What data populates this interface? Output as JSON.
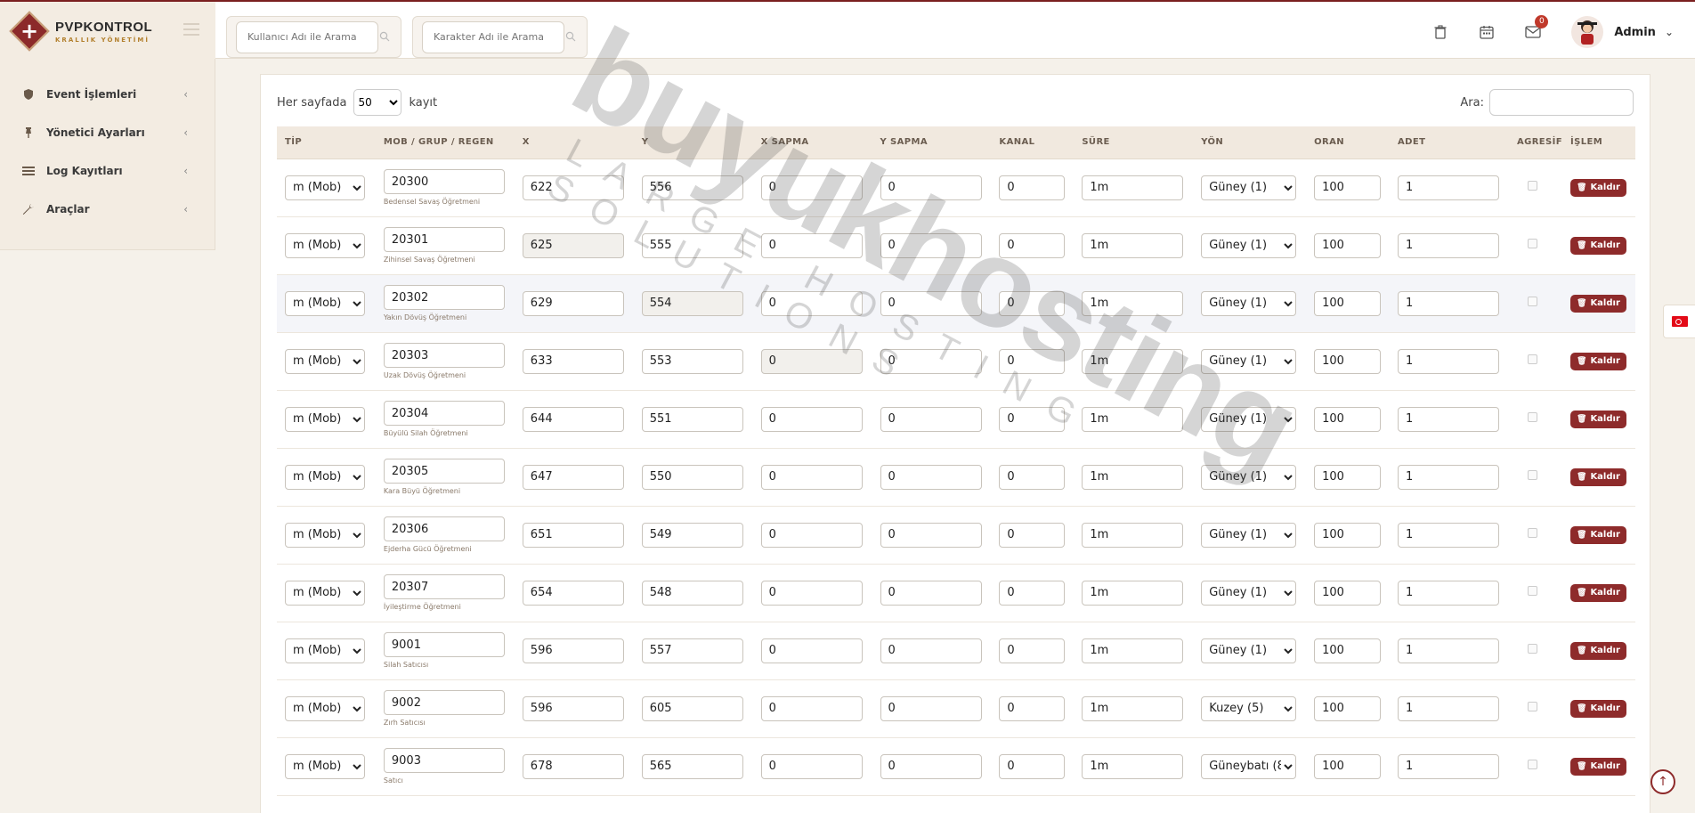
{
  "brand": {
    "title": "PVPKONTROL",
    "subtitle": "KRALLIK YÖNETİMİ"
  },
  "search": {
    "user_placeholder": "Kullanıcı Adı ile Arama",
    "char_placeholder": "Karakter Adı ile Arama"
  },
  "header": {
    "mail_badge": "0",
    "admin_name": "Admin"
  },
  "sidebar": {
    "items": [
      {
        "label": "Event İşlemleri",
        "icon": "shield-icon"
      },
      {
        "label": "Yönetici Ayarları",
        "icon": "pin-icon"
      },
      {
        "label": "Log Kayıtları",
        "icon": "list-icon"
      },
      {
        "label": "Araçlar",
        "icon": "wrench-icon"
      }
    ]
  },
  "table_controls": {
    "per_page_prefix": "Her sayfada",
    "per_page_value": "50",
    "per_page_suffix": "kayıt",
    "search_label": "Ara:"
  },
  "columns": [
    "TİP",
    "MOB / GRUP / REGEN",
    "X",
    "Y",
    "X SAPMA",
    "Y SAPMA",
    "KANAL",
    "SÜRE",
    "YÖN",
    "ORAN",
    "ADET",
    "AGRESİF",
    "İŞLEM"
  ],
  "delete_label": "Kaldır",
  "rows": [
    {
      "tip": "m (Mob)",
      "mob": "20300",
      "mob_name": "Bedensel Savaş Öğretmeni",
      "x": "622",
      "y": "556",
      "xs": "0",
      "ys": "0",
      "kanal": "0",
      "sure": "1m",
      "yon": "Güney (1)",
      "oran": "100",
      "adet": "1"
    },
    {
      "tip": "m (Mob)",
      "mob": "20301",
      "mob_name": "Zihinsel Savaş Öğretmeni",
      "x": "625",
      "y": "555",
      "xs": "0",
      "ys": "0",
      "kanal": "0",
      "sure": "1m",
      "yon": "Güney (1)",
      "oran": "100",
      "adet": "1"
    },
    {
      "tip": "m (Mob)",
      "mob": "20302",
      "mob_name": "Yakın Dövüş Öğretmeni",
      "x": "629",
      "y": "554",
      "xs": "0",
      "ys": "0",
      "kanal": "0",
      "sure": "1m",
      "yon": "Güney (1)",
      "oran": "100",
      "adet": "1"
    },
    {
      "tip": "m (Mob)",
      "mob": "20303",
      "mob_name": "Uzak Dövüş Öğretmeni",
      "x": "633",
      "y": "553",
      "xs": "0",
      "ys": "0",
      "kanal": "0",
      "sure": "1m",
      "yon": "Güney (1)",
      "oran": "100",
      "adet": "1"
    },
    {
      "tip": "m (Mob)",
      "mob": "20304",
      "mob_name": "Büyülü Silah Öğretmeni",
      "x": "644",
      "y": "551",
      "xs": "0",
      "ys": "0",
      "kanal": "0",
      "sure": "1m",
      "yon": "Güney (1)",
      "oran": "100",
      "adet": "1"
    },
    {
      "tip": "m (Mob)",
      "mob": "20305",
      "mob_name": "Kara Büyü Öğretmeni",
      "x": "647",
      "y": "550",
      "xs": "0",
      "ys": "0",
      "kanal": "0",
      "sure": "1m",
      "yon": "Güney (1)",
      "oran": "100",
      "adet": "1"
    },
    {
      "tip": "m (Mob)",
      "mob": "20306",
      "mob_name": "Ejderha Gücü Öğretmeni",
      "x": "651",
      "y": "549",
      "xs": "0",
      "ys": "0",
      "kanal": "0",
      "sure": "1m",
      "yon": "Güney (1)",
      "oran": "100",
      "adet": "1"
    },
    {
      "tip": "m (Mob)",
      "mob": "20307",
      "mob_name": "İyileştirme Öğretmeni",
      "x": "654",
      "y": "548",
      "xs": "0",
      "ys": "0",
      "kanal": "0",
      "sure": "1m",
      "yon": "Güney (1)",
      "oran": "100",
      "adet": "1"
    },
    {
      "tip": "m (Mob)",
      "mob": "9001",
      "mob_name": "Silah Satıcısı",
      "x": "596",
      "y": "557",
      "xs": "0",
      "ys": "0",
      "kanal": "0",
      "sure": "1m",
      "yon": "Güney (1)",
      "oran": "100",
      "adet": "1"
    },
    {
      "tip": "m (Mob)",
      "mob": "9002",
      "mob_name": "Zırh Satıcısı",
      "x": "596",
      "y": "605",
      "xs": "0",
      "ys": "0",
      "kanal": "0",
      "sure": "1m",
      "yon": "Kuzey (5)",
      "oran": "100",
      "adet": "1"
    },
    {
      "tip": "m (Mob)",
      "mob": "9003",
      "mob_name": "Satıcı",
      "x": "678",
      "y": "565",
      "xs": "0",
      "ys": "0",
      "kanal": "0",
      "sure": "1m",
      "yon": "Güneybatı (8",
      "oran": "100",
      "adet": "1"
    }
  ],
  "watermark": {
    "main": "buyukhosting",
    "sub": "LARGE HOSTING SOLUTIONS"
  }
}
